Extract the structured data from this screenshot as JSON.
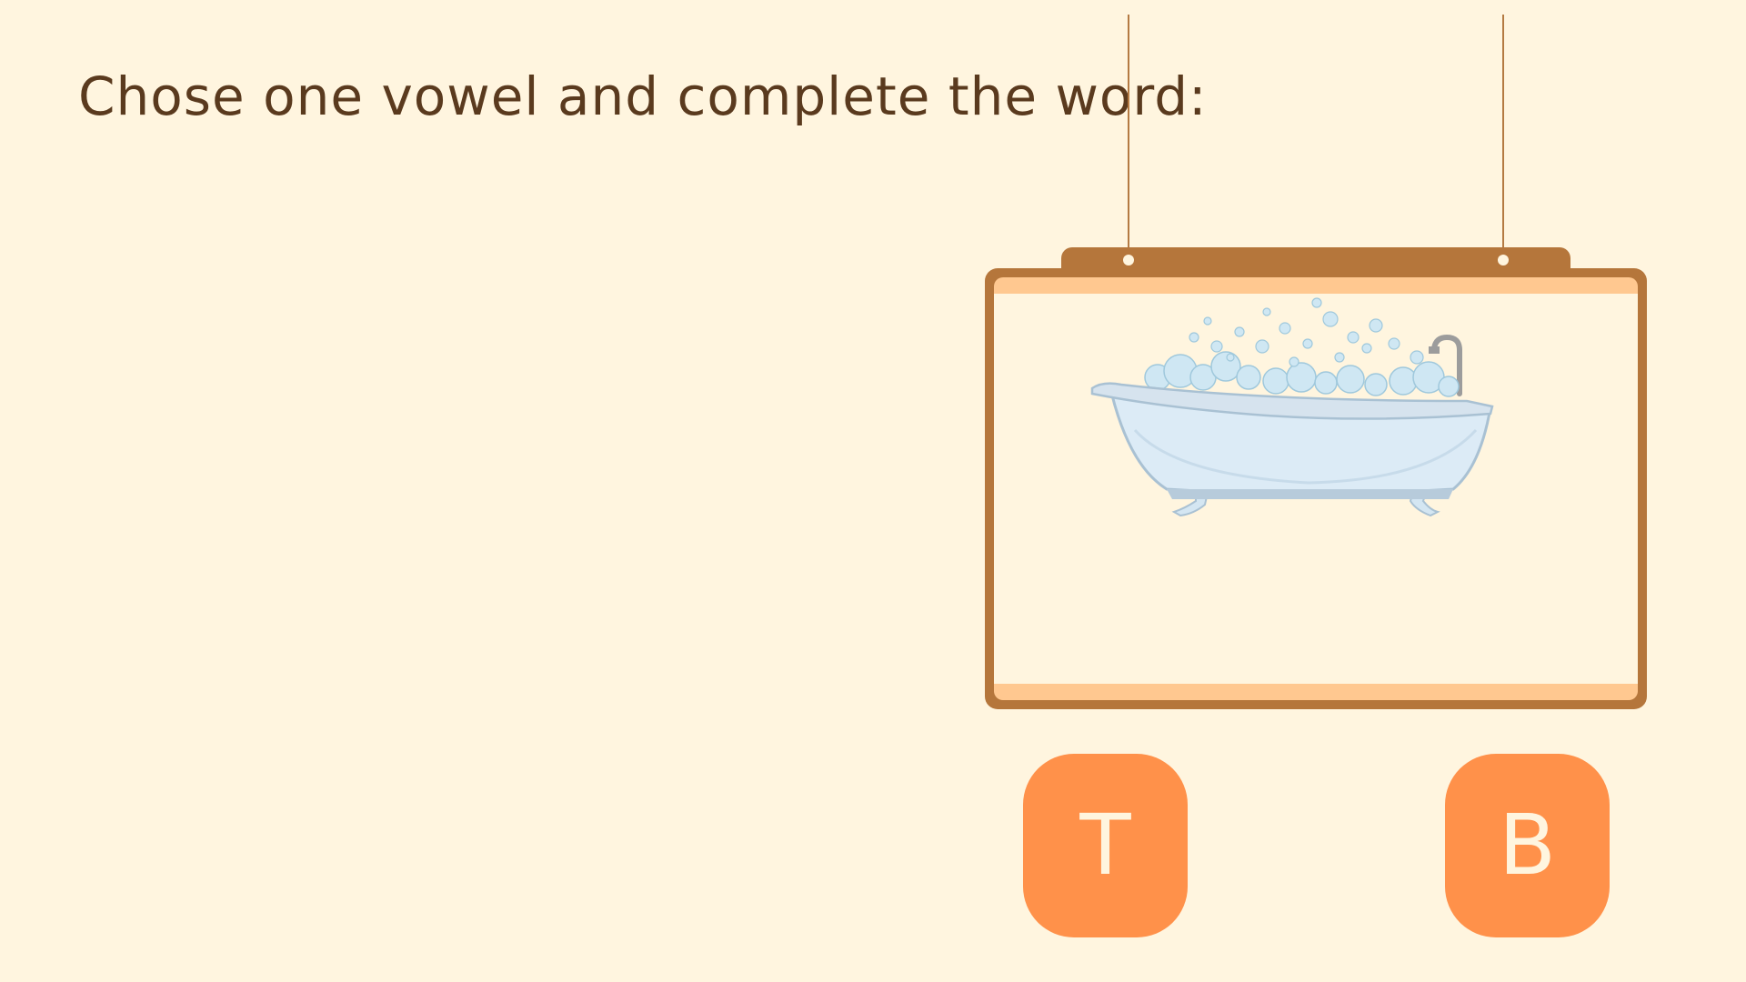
{
  "instruction": "Chose one vowel and complete the word:",
  "picture": {
    "subject": "bathtub",
    "icon": "bathtub-with-bubbles"
  },
  "options": [
    "T",
    "B"
  ],
  "colors": {
    "background": "#FFF5DF",
    "title": "#5A3A1E",
    "frame": "#B5763B",
    "frame_accent": "#FFC890",
    "button": "#FF914A",
    "button_text": "#FFF5DF"
  }
}
